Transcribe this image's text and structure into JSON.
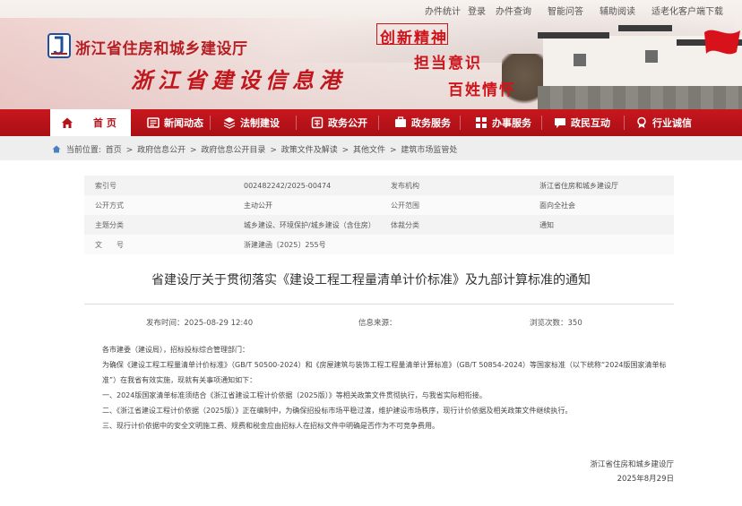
{
  "toplinks": {
    "stats": "办件统计",
    "login": "登录",
    "query": "办件查询",
    "qa": "智能问答",
    "reading": "辅助阅读",
    "elder": "适老化客户端下载"
  },
  "banner": {
    "site_name": "浙江省住房和城乡建设厅",
    "port_name": "浙江省建设信息港",
    "slogans": [
      "创新精神",
      "担当意识",
      "百姓情怀"
    ]
  },
  "nav": {
    "items": [
      {
        "label": "首 页",
        "icon": "home-icon"
      },
      {
        "label": "新闻动态",
        "icon": "news-icon"
      },
      {
        "label": "法制建设",
        "icon": "layers-icon"
      },
      {
        "label": "政务公开",
        "icon": "gov-icon"
      },
      {
        "label": "政务服务",
        "icon": "service-icon"
      },
      {
        "label": "办事服务",
        "icon": "grid-icon"
      },
      {
        "label": "政民互动",
        "icon": "chat-icon"
      },
      {
        "label": "行业诚信",
        "icon": "badge-icon"
      }
    ]
  },
  "breadcrumb": {
    "prefix": "当前位置:",
    "items": [
      "首页",
      "政府信息公开",
      "政府信息公开目录",
      "政策文件及解读",
      "其他文件",
      "建筑市场监管处"
    ],
    "sep": ">"
  },
  "info": {
    "rows": [
      [
        "索引号",
        "002482242/2025-00474",
        "发布机构",
        "浙江省住房和城乡建设厅"
      ],
      [
        "公开方式",
        "主动公开",
        "公开范围",
        "面向全社会"
      ],
      [
        "主题分类",
        "城乡建设、环境保护/城乡建设（含住房）",
        "体裁分类",
        "通知"
      ],
      [
        "文　　号",
        "浙建建函〔2025〕255号",
        "",
        ""
      ]
    ]
  },
  "doc": {
    "title": "省建设厅关于贯彻落实《建设工程工程量清单计价标准》及九部计算标准的通知",
    "publish_time": "发布时间：2025-08-29 12:40",
    "source": "信息来源：",
    "views": "浏览次数：350",
    "salutation": "各市建委（建设局），招标投标综合管理部门：",
    "para1": "为确保《建设工程工程量清单计价标准》（GB/T 50500-2024）和《房屋建筑与装饰工程工程量清单计算标准》（GB/T 50854-2024）等国家标准（以下统称“2024版国家清单标准”）在我省有效实施，现就有关事项通知如下：",
    "item1": "一、2024版国家清单标准须结合《浙江省建设工程计价依据（2025版）》等相关政策文件贯彻执行，与我省实际相衔接。",
    "item2": "二、《浙江省建设工程计价依据（2025版）》正在编制中，为确保招投标市场平稳过渡，维护建设市场秩序，现行计价依据及相关政策文件继续执行。",
    "item3": "三、现行计价依据中的安全文明施工费、规费和税金应由招标人在招标文件中明确是否作为不可竞争费用。",
    "sign_org": "浙江省住房和城乡建设厅",
    "sign_date": "2025年8月29日"
  },
  "colors": {
    "brand_red": "#b51f24",
    "nav_red": "#c8171e"
  }
}
